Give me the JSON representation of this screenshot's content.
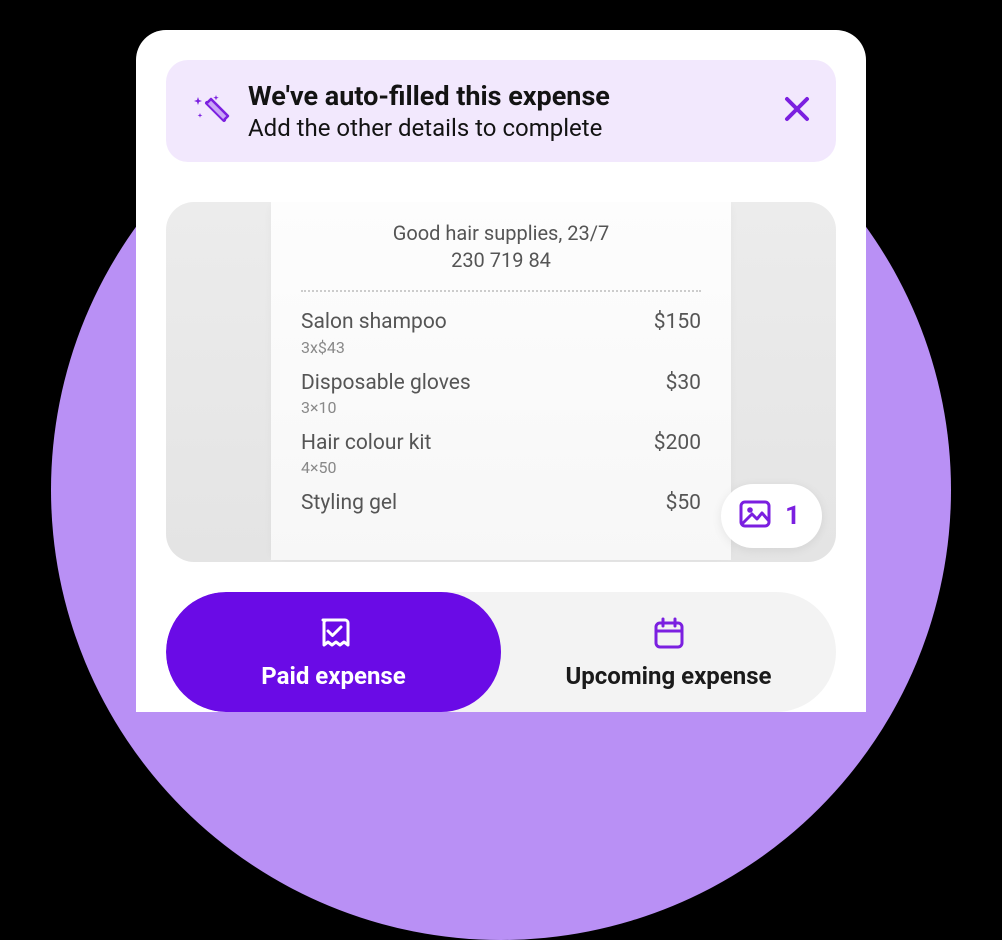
{
  "banner": {
    "title": "We've auto-filled this expense",
    "subtitle": "Add the other details to complete"
  },
  "receipt": {
    "store_line": "Good hair supplies, 23/7",
    "phone_line": "230 719 84",
    "items": [
      {
        "name": "Salon shampoo",
        "sub": "3x$43",
        "price": "$150"
      },
      {
        "name": "Disposable gloves",
        "sub": "3×10",
        "price": "$30"
      },
      {
        "name": "Hair colour kit",
        "sub": "4×50",
        "price": "$200"
      },
      {
        "name": "Styling gel",
        "sub": "",
        "price": "$50"
      }
    ]
  },
  "attachment": {
    "count": "1"
  },
  "tabs": {
    "paid": "Paid expense",
    "upcoming": "Upcoming expense"
  }
}
